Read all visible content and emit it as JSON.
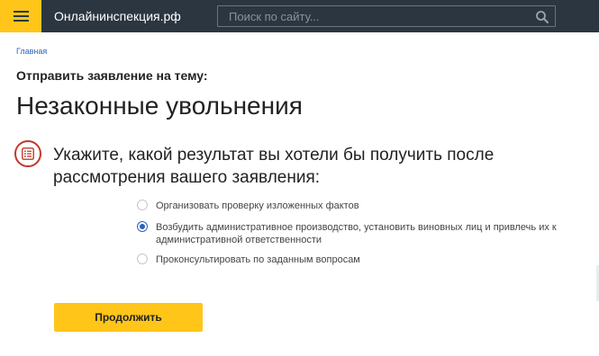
{
  "header": {
    "site_title": "Онлайнинспекция.рф",
    "search_placeholder": "Поиск по сайту..."
  },
  "breadcrumb": {
    "home": "Главная"
  },
  "main": {
    "topic_label": "Отправить заявление на тему:",
    "title": "Незаконные увольнения",
    "question": "Укажите, какой результат вы хотели бы получить после рассмотрения вашего заявления:",
    "options": [
      {
        "label": "Организовать проверку изложенных фактов",
        "selected": false
      },
      {
        "label": "Возбудить административное производство, установить виновных лиц и привлечь их к административной ответственности",
        "selected": true
      },
      {
        "label": "Проконсультировать по заданным вопросам",
        "selected": false
      }
    ],
    "continue_label": "Продолжить"
  },
  "colors": {
    "header_bg": "#2c3641",
    "accent_yellow": "#ffc619",
    "link_blue": "#2a62b8",
    "icon_red": "#c0392b"
  },
  "icons": [
    "menu-icon",
    "search-icon",
    "document-list-icon"
  ]
}
